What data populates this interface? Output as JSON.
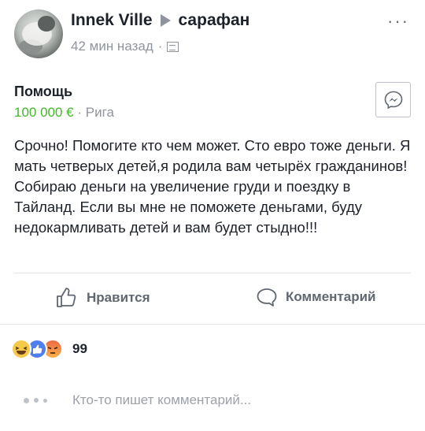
{
  "post": {
    "author": "Innek Ville",
    "group": "сарафан",
    "time": "42 мин назад",
    "sale": {
      "title": "Помощь",
      "price": "100 000 €",
      "separator": "·",
      "location": "Рига"
    },
    "text": "Срочно! Помогите кто чем может. Сто евро тоже деньги. Я мать четверых детей,я родила вам четырёх гражданинов! Собираю деньги на увеличение груди и поездку в Тайланд. Если вы мне не поможете деньгами, буду недокармливать детей и вам будет стыдно!!!"
  },
  "actions": {
    "like_label": "Нравится",
    "comment_label": "Комментарий"
  },
  "reactions": {
    "count": "99",
    "types": [
      "haha",
      "like",
      "angry"
    ]
  },
  "typing": {
    "text": "Кто-то пишет комментарий..."
  },
  "colors": {
    "price": "#42b72a",
    "secondary_text": "#90949c",
    "action_text": "#606770",
    "like_reaction": "#4f7fef",
    "haha_reaction": "#f7c94b"
  },
  "icons": [
    "more-icon",
    "globe-icon",
    "messenger-icon",
    "like-icon",
    "comment-icon",
    "typing-dots-icon"
  ]
}
